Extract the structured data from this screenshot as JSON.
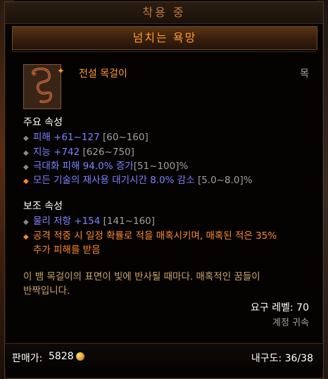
{
  "header": {
    "equipped": "착용 중"
  },
  "item": {
    "name": "넘치는 욕망",
    "type": "전설 목걸이",
    "slot": "목",
    "star_icon": "star-icon",
    "icon": "serpent-necklace-icon"
  },
  "primary": {
    "title": "주요 속성",
    "props": [
      {
        "value": "피해 +61~127",
        "range": "[60~160]"
      },
      {
        "value": "지능 +742",
        "range": "[626~750]"
      },
      {
        "value": "극대화 피해 94.0% 증가",
        "range": "[51~100]%"
      },
      {
        "value": "모든 기술의 재사용 대기시간 8.0% 감소",
        "range": "[5.0~8.0]%"
      }
    ]
  },
  "secondary": {
    "title": "보조 속성",
    "props": [
      {
        "value": "물리 저항 +154",
        "range": "[141~160]"
      }
    ],
    "legendary_line1": "공격 적중 시 일정 확률로 적을 매혹시키며, 매혹된 적은 35%",
    "legendary_line2": "추가 피해를 받음"
  },
  "flavor": {
    "line1": "이 뱀 목걸이의 표면이 빛에 반사될 때마다. 매혹적인 꿈들이",
    "line2": "반짝입니다."
  },
  "requirements": {
    "level": "요구 레벨: 70",
    "binding": "계정 귀속"
  },
  "footer": {
    "price_label": "판매가:",
    "price_value": "5828",
    "durability": "내구도: 36/38"
  },
  "colors": {
    "legendary": "#ff9a30",
    "magic_blue": "#7c82ff",
    "flavor": "#c8a46a"
  }
}
